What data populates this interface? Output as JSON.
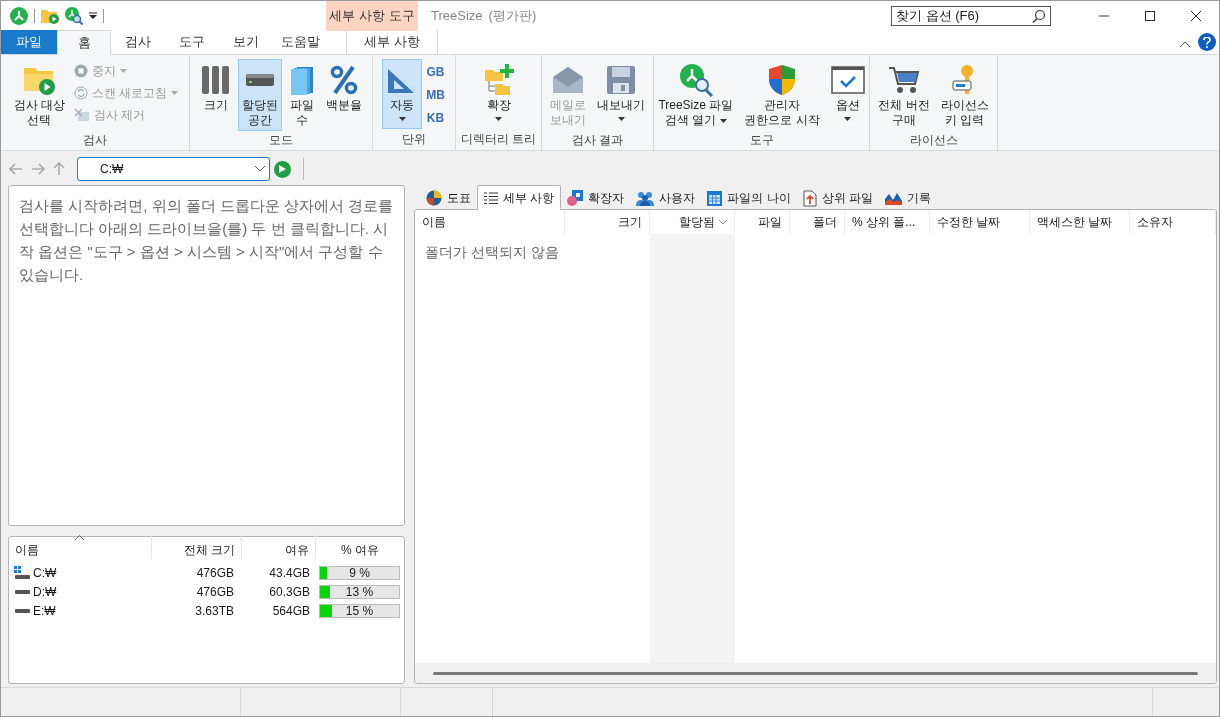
{
  "title_bar": {
    "context_group": "세부 사항 도구",
    "app_name": "TreeSize",
    "edition": "(평가판)",
    "search": {
      "placeholder": "찾기 옵션 (F6)"
    }
  },
  "ribbon_tabs": [
    {
      "label": "파일",
      "kind": "file",
      "selected": false
    },
    {
      "label": "홈",
      "kind": "normal",
      "selected": true
    },
    {
      "label": "검사",
      "kind": "normal",
      "selected": false
    },
    {
      "label": "도구",
      "kind": "normal",
      "selected": false
    },
    {
      "label": "보기",
      "kind": "normal",
      "selected": false
    },
    {
      "label": "도움말",
      "kind": "normal",
      "selected": false
    },
    {
      "label": "세부 사항",
      "kind": "contextual",
      "selected": false
    }
  ],
  "ribbon_groups": [
    {
      "label": "검사",
      "buttons": [
        {
          "kind": "large",
          "label": "검사 대상\n선택",
          "dropdown": false,
          "disabled": false,
          "selected": false
        },
        {
          "kind": "small",
          "label": "중지",
          "dropdown": true,
          "disabled": true,
          "selected": false
        },
        {
          "kind": "small",
          "label": "스캔 새로고침",
          "dropdown": true,
          "disabled": true,
          "selected": false
        },
        {
          "kind": "small",
          "label": "검사 제거",
          "dropdown": false,
          "disabled": true,
          "selected": false
        }
      ]
    },
    {
      "label": "모드",
      "buttons": [
        {
          "kind": "large",
          "label": "크기",
          "dropdown": false,
          "disabled": false,
          "selected": false
        },
        {
          "kind": "large",
          "label": "할당된\n공간",
          "dropdown": false,
          "disabled": false,
          "selected": true
        },
        {
          "kind": "large",
          "label": "파일\n수",
          "dropdown": false,
          "disabled": false,
          "selected": false
        },
        {
          "kind": "large",
          "label": "백분율",
          "dropdown": false,
          "disabled": false,
          "selected": false
        }
      ]
    },
    {
      "label": "단위",
      "buttons": [
        {
          "kind": "large",
          "label": "자동",
          "dropdown": true,
          "disabled": false,
          "selected": true
        },
        {
          "kind": "unit",
          "label": "GB"
        },
        {
          "kind": "unit",
          "label": "MB"
        },
        {
          "kind": "unit",
          "label": "KB"
        }
      ]
    },
    {
      "label": "디렉터리 트리",
      "buttons": [
        {
          "kind": "large",
          "label": "확장",
          "dropdown": true,
          "disabled": false,
          "selected": false
        }
      ]
    },
    {
      "label": "검사 결과",
      "buttons": [
        {
          "kind": "large",
          "label": "메일로\n보내기",
          "dropdown": false,
          "disabled": true,
          "selected": false
        },
        {
          "kind": "large",
          "label": "내보내기",
          "dropdown": true,
          "disabled": false,
          "selected": false
        }
      ]
    },
    {
      "label": "도구",
      "buttons": [
        {
          "kind": "large",
          "label": "TreeSize 파일\n검색 열기",
          "dropdown": true,
          "disabled": false,
          "selected": false
        },
        {
          "kind": "large",
          "label": "관리자\n권한으로 시작",
          "dropdown": false,
          "disabled": false,
          "selected": false
        },
        {
          "kind": "large",
          "label": "옵션",
          "dropdown": true,
          "disabled": false,
          "selected": false
        }
      ]
    },
    {
      "label": "라이선스",
      "buttons": [
        {
          "kind": "large",
          "label": "전체 버전\n구매",
          "dropdown": false,
          "disabled": false,
          "selected": false
        },
        {
          "kind": "large",
          "label": "라이선스\n키 입력",
          "dropdown": false,
          "disabled": false,
          "selected": false
        }
      ]
    }
  ],
  "address_bar": {
    "value": "C:₩"
  },
  "info_text": "검사를 시작하려면, 위의 폴더 드롭다운 상자에서 경로를 선택합니다 아래의 드라이브을(를) 두 번 클릭합니다. 시작 옵션은 \"도구 > 옵션 > 시스템 > 시작\"에서 구성할 수 있습니다.",
  "drives": {
    "columns": [
      {
        "label": "이름",
        "sorted": true,
        "descending": false
      },
      {
        "label": "전체 크기",
        "sorted": false
      },
      {
        "label": "여유",
        "sorted": false
      },
      {
        "label": "% 여유",
        "sorted": false
      }
    ],
    "rows": [
      {
        "kind": "system",
        "name": "C:₩",
        "total": "476GB",
        "free": "43.4GB",
        "percent": "9 %",
        "level": 0.09
      },
      {
        "kind": "plain",
        "name": "D:₩",
        "total": "476GB",
        "free": "60.3GB",
        "percent": "13 %",
        "level": 0.13
      },
      {
        "kind": "plain",
        "name": "E:₩",
        "total": "3.63TB",
        "free": "564GB",
        "percent": "15 %",
        "level": 0.15
      }
    ]
  },
  "view_tabs": [
    {
      "label": "도표",
      "selected": false
    },
    {
      "label": "세부 사항",
      "selected": true
    },
    {
      "label": "확장자",
      "selected": false
    },
    {
      "label": "사용자",
      "selected": false
    },
    {
      "label": "파일의 나이",
      "selected": false
    },
    {
      "label": "상위 파일",
      "selected": false
    },
    {
      "label": "기록",
      "selected": false
    }
  ],
  "details": {
    "columns": [
      {
        "label": "이름",
        "sorted": false
      },
      {
        "label": "크기",
        "sorted": false
      },
      {
        "label": "할당됨",
        "sorted": true,
        "descending": true
      },
      {
        "label": "파일",
        "sorted": false
      },
      {
        "label": "폴더",
        "sorted": false
      },
      {
        "label": "% 상위 폴...",
        "sorted": false
      },
      {
        "label": "수정한 날짜",
        "sorted": false
      },
      {
        "label": "액세스한 날짜",
        "sorted": false
      },
      {
        "label": "소유자",
        "sorted": false
      }
    ],
    "empty_message": "폴더가 선택되지 않음"
  }
}
